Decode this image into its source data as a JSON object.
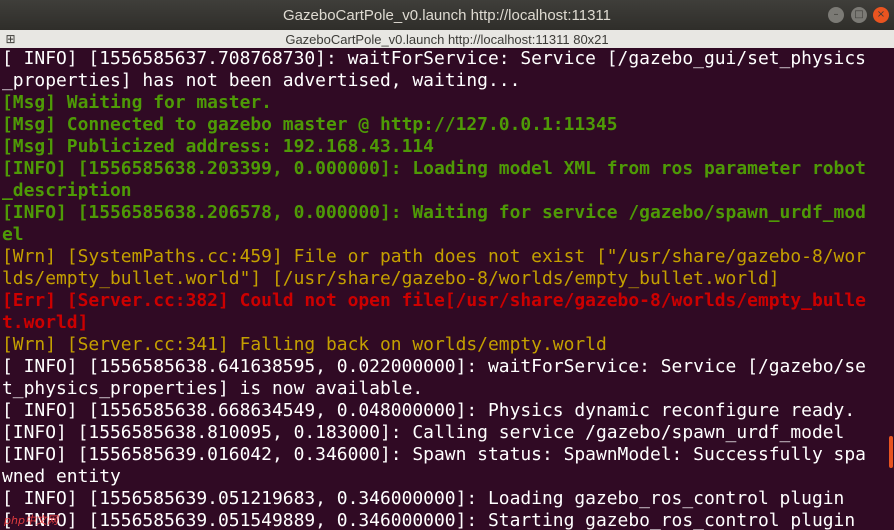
{
  "window": {
    "title": "GazeboCartPole_v0.launch http://localhost:11311",
    "subtitle": "GazeboCartPole_v0.launch http://localhost:11311 80x21",
    "controls": {
      "minimize": "–",
      "maximize": "□",
      "close": "×"
    }
  },
  "terminal": {
    "lines": [
      {
        "style": "default",
        "text": "[ INFO] [1556585637.708768730]: waitForService: Service [/gazebo_gui/set_physics"
      },
      {
        "style": "default",
        "text": "_properties] has not been advertised, waiting..."
      },
      {
        "style": "msg",
        "text": "[Msg] Waiting for master."
      },
      {
        "style": "msg",
        "text": "[Msg] Connected to gazebo master @ http://127.0.0.1:11345"
      },
      {
        "style": "msg",
        "text": "[Msg] Publicized address: 192.168.43.114"
      },
      {
        "style": "green",
        "text": "[INFO] [1556585638.203399, 0.000000]: Loading model XML from ros parameter robot"
      },
      {
        "style": "green",
        "text": "_description"
      },
      {
        "style": "green",
        "text": "[INFO] [1556585638.206578, 0.000000]: Waiting for service /gazebo/spawn_urdf_mod"
      },
      {
        "style": "green",
        "text": "el"
      },
      {
        "style": "warn",
        "text": "[Wrn] [SystemPaths.cc:459] File or path does not exist [\"/usr/share/gazebo-8/wor"
      },
      {
        "style": "warn",
        "text": "lds/empty_bullet.world\"] [/usr/share/gazebo-8/worlds/empty_bullet.world]"
      },
      {
        "style": "err",
        "text": "[Err] [Server.cc:382] Could not open file[/usr/share/gazebo-8/worlds/empty_bulle"
      },
      {
        "style": "err",
        "text": "t.world]"
      },
      {
        "style": "warn",
        "text": "[Wrn] [Server.cc:341] Falling back on worlds/empty.world"
      },
      {
        "style": "default",
        "text": "[ INFO] [1556585638.641638595, 0.022000000]: waitForService: Service [/gazebo/se"
      },
      {
        "style": "default",
        "text": "t_physics_properties] is now available."
      },
      {
        "style": "default",
        "text": "[ INFO] [1556585638.668634549, 0.048000000]: Physics dynamic reconfigure ready."
      },
      {
        "style": "default",
        "text": "[INFO] [1556585638.810095, 0.183000]: Calling service /gazebo/spawn_urdf_model"
      },
      {
        "style": "default",
        "text": "[INFO] [1556585639.016042, 0.346000]: Spawn status: SpawnModel: Successfully spa"
      },
      {
        "style": "default",
        "text": "wned entity"
      },
      {
        "style": "default",
        "text": "[ INFO] [1556585639.051219683, 0.346000000]: Loading gazebo_ros_control plugin"
      },
      {
        "style": "default",
        "text": "[ INFO] [1556585639.051549889, 0.346000000]: Starting gazebo_ros_control plugin"
      }
    ]
  },
  "colors": {
    "terminal_bg": "#300a24",
    "default_text": "#ffffff",
    "msg_green": "#4e9a06",
    "warning_yellow": "#c4a000",
    "error_red": "#cc0000",
    "scroll_thumb": "#e95420"
  },
  "watermark": {
    "logo": "php中文网"
  }
}
